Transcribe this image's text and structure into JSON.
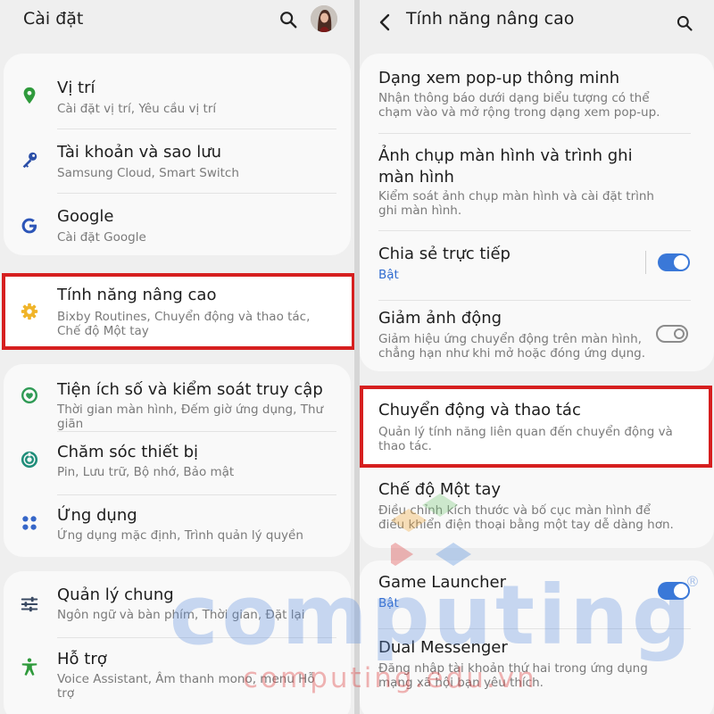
{
  "left": {
    "header": {
      "title": "Cài đặt"
    },
    "items": [
      {
        "title": "Vị trí",
        "subtitle": "Cài đặt vị trí, Yêu cầu vị trí"
      },
      {
        "title": "Tài khoản và sao lưu",
        "subtitle": "Samsung Cloud, Smart Switch"
      },
      {
        "title": "Google",
        "subtitle": "Cài đặt Google"
      },
      {
        "title": "Tính năng nâng cao",
        "subtitle": "Bixby Routines, Chuyển động và thao tác, Chế độ Một tay"
      },
      {
        "title": "Tiện ích số và kiểm soát truy cập",
        "subtitle": "Thời gian màn hình, Đếm giờ ứng dụng, Thư giãn"
      },
      {
        "title": "Chăm sóc thiết bị",
        "subtitle": "Pin, Lưu trữ, Bộ nhớ, Bảo mật"
      },
      {
        "title": "Ứng dụng",
        "subtitle": "Ứng dụng mặc định, Trình quản lý quyền"
      },
      {
        "title": "Quản lý chung",
        "subtitle": "Ngôn ngữ và bàn phím, Thời gian, Đặt lại"
      },
      {
        "title": "Hỗ trợ",
        "subtitle": "Voice Assistant, Âm thanh mono, menu Hỗ trợ"
      }
    ]
  },
  "right": {
    "header": {
      "title": "Tính năng nâng cao"
    },
    "items": [
      {
        "title": "Dạng xem pop-up thông minh",
        "subtitle": "Nhận thông báo dưới dạng biểu tượng có thể chạm vào và mở rộng trong dạng xem pop-up."
      },
      {
        "title": "Ảnh chụp màn hình và trình ghi màn hình",
        "subtitle": "Kiểm soát ảnh chụp màn hình và cài đặt trình ghi màn hình."
      },
      {
        "title": "Chia sẻ trực tiếp",
        "subtitle": "Bật",
        "toggle": "on"
      },
      {
        "title": "Giảm ảnh động",
        "subtitle": "Giảm hiệu ứng chuyển động trên màn hình, chẳng hạn như khi mở hoặc đóng ứng dụng.",
        "toggle": "off"
      },
      {
        "title": "Chuyển động và thao tác",
        "subtitle": "Quản lý tính năng liên quan đến chuyển động và thao tác."
      },
      {
        "title": "Chế độ Một tay",
        "subtitle": "Điều chỉnh kích thước và bố cục màn hình để điều khiển điện thoại bằng một tay dễ dàng hơn."
      },
      {
        "title": "Game Launcher",
        "subtitle": "Bật",
        "toggle": "on"
      },
      {
        "title": "Dual Messenger",
        "subtitle": "Đăng nhập tài khoản thứ hai trong ứng dụng mạng xã hội bạn yêu thích."
      }
    ]
  },
  "watermark": {
    "brand": "computing",
    "domain": "computing.edu.vn",
    "mark": "®"
  },
  "colors": {
    "highlight": "#d61f1f",
    "toggle_on": "#3a78d8",
    "accent_text": "#2f6bd0",
    "card": "#f9f9f9",
    "background": "#efefef"
  }
}
